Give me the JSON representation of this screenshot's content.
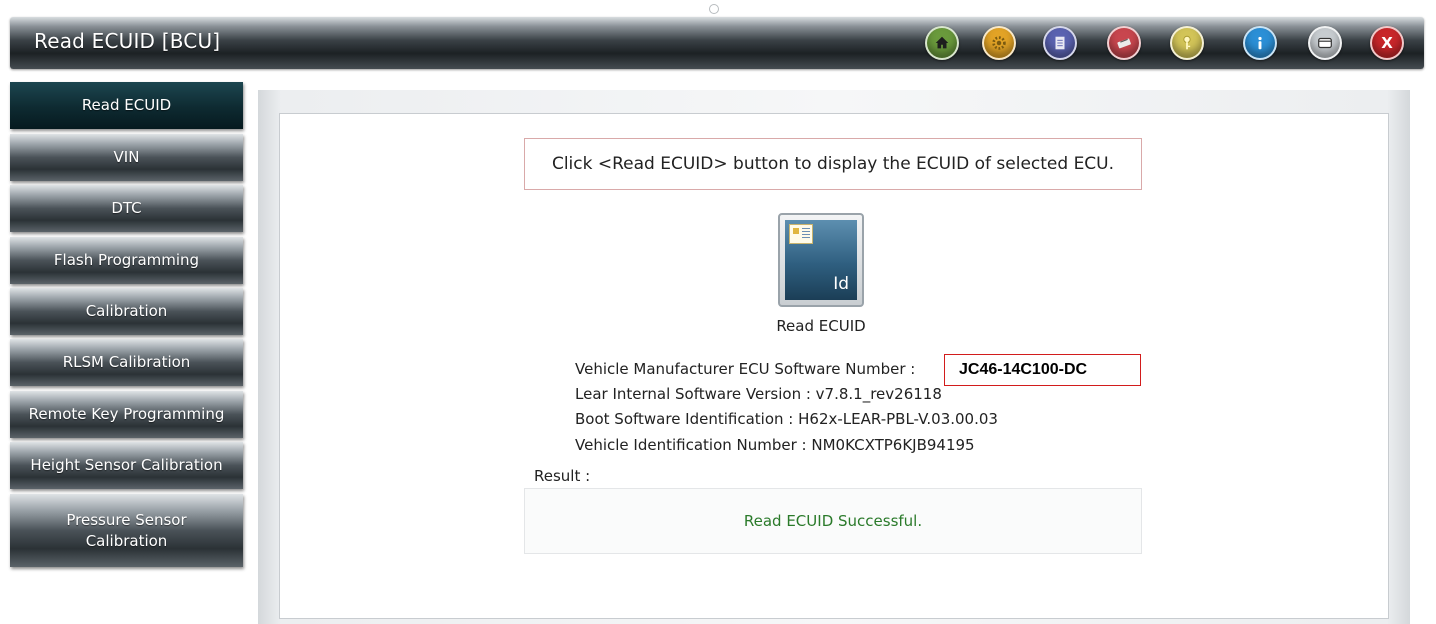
{
  "window": {
    "title": "Read ECUID [BCU]",
    "toolbar_icons": [
      {
        "name": "home-icon",
        "color": "#6a9a3c"
      },
      {
        "name": "settings-icon",
        "color": "#e2a326"
      },
      {
        "name": "notes-icon",
        "color": "#5a62b0"
      },
      {
        "name": "vci-icon",
        "color": "#c8464e"
      },
      {
        "name": "key-icon",
        "color": "#d2c458"
      },
      {
        "name": "info-icon",
        "color": "#2b8fd6"
      },
      {
        "name": "window-icon",
        "color": "#c7ccd0"
      },
      {
        "name": "close-icon",
        "color": "#c8262a",
        "glyph": "X"
      }
    ]
  },
  "sidebar": {
    "items": [
      {
        "label": "Read ECUID",
        "active": true
      },
      {
        "label": "VIN"
      },
      {
        "label": "DTC"
      },
      {
        "label": "Flash Programming"
      },
      {
        "label": "Calibration"
      },
      {
        "label": "RLSM Calibration"
      },
      {
        "label": "Remote Key Programming"
      },
      {
        "label": "Height Sensor Calibration"
      },
      {
        "label": "Pressure Sensor Calibration"
      }
    ]
  },
  "main": {
    "instruction": "Click <Read ECUID> button to display the ECUID of selected ECU.",
    "read_button": {
      "icon_text": "Id",
      "label": "Read ECUID"
    },
    "info": {
      "sw_number_label": "Vehicle Manufacturer ECU Software Number :",
      "sw_number_value": "JC46-14C100-DC",
      "lear_version": "Lear Internal Software Version : v7.8.1_rev26118",
      "boot_sw": "Boot Software Identification : H62x-LEAR-PBL-V.03.00.03",
      "vin": "Vehicle Identification Number : NM0KCXTP6KJB94195"
    },
    "result": {
      "label": "Result :",
      "message": "Read ECUID Successful."
    }
  }
}
